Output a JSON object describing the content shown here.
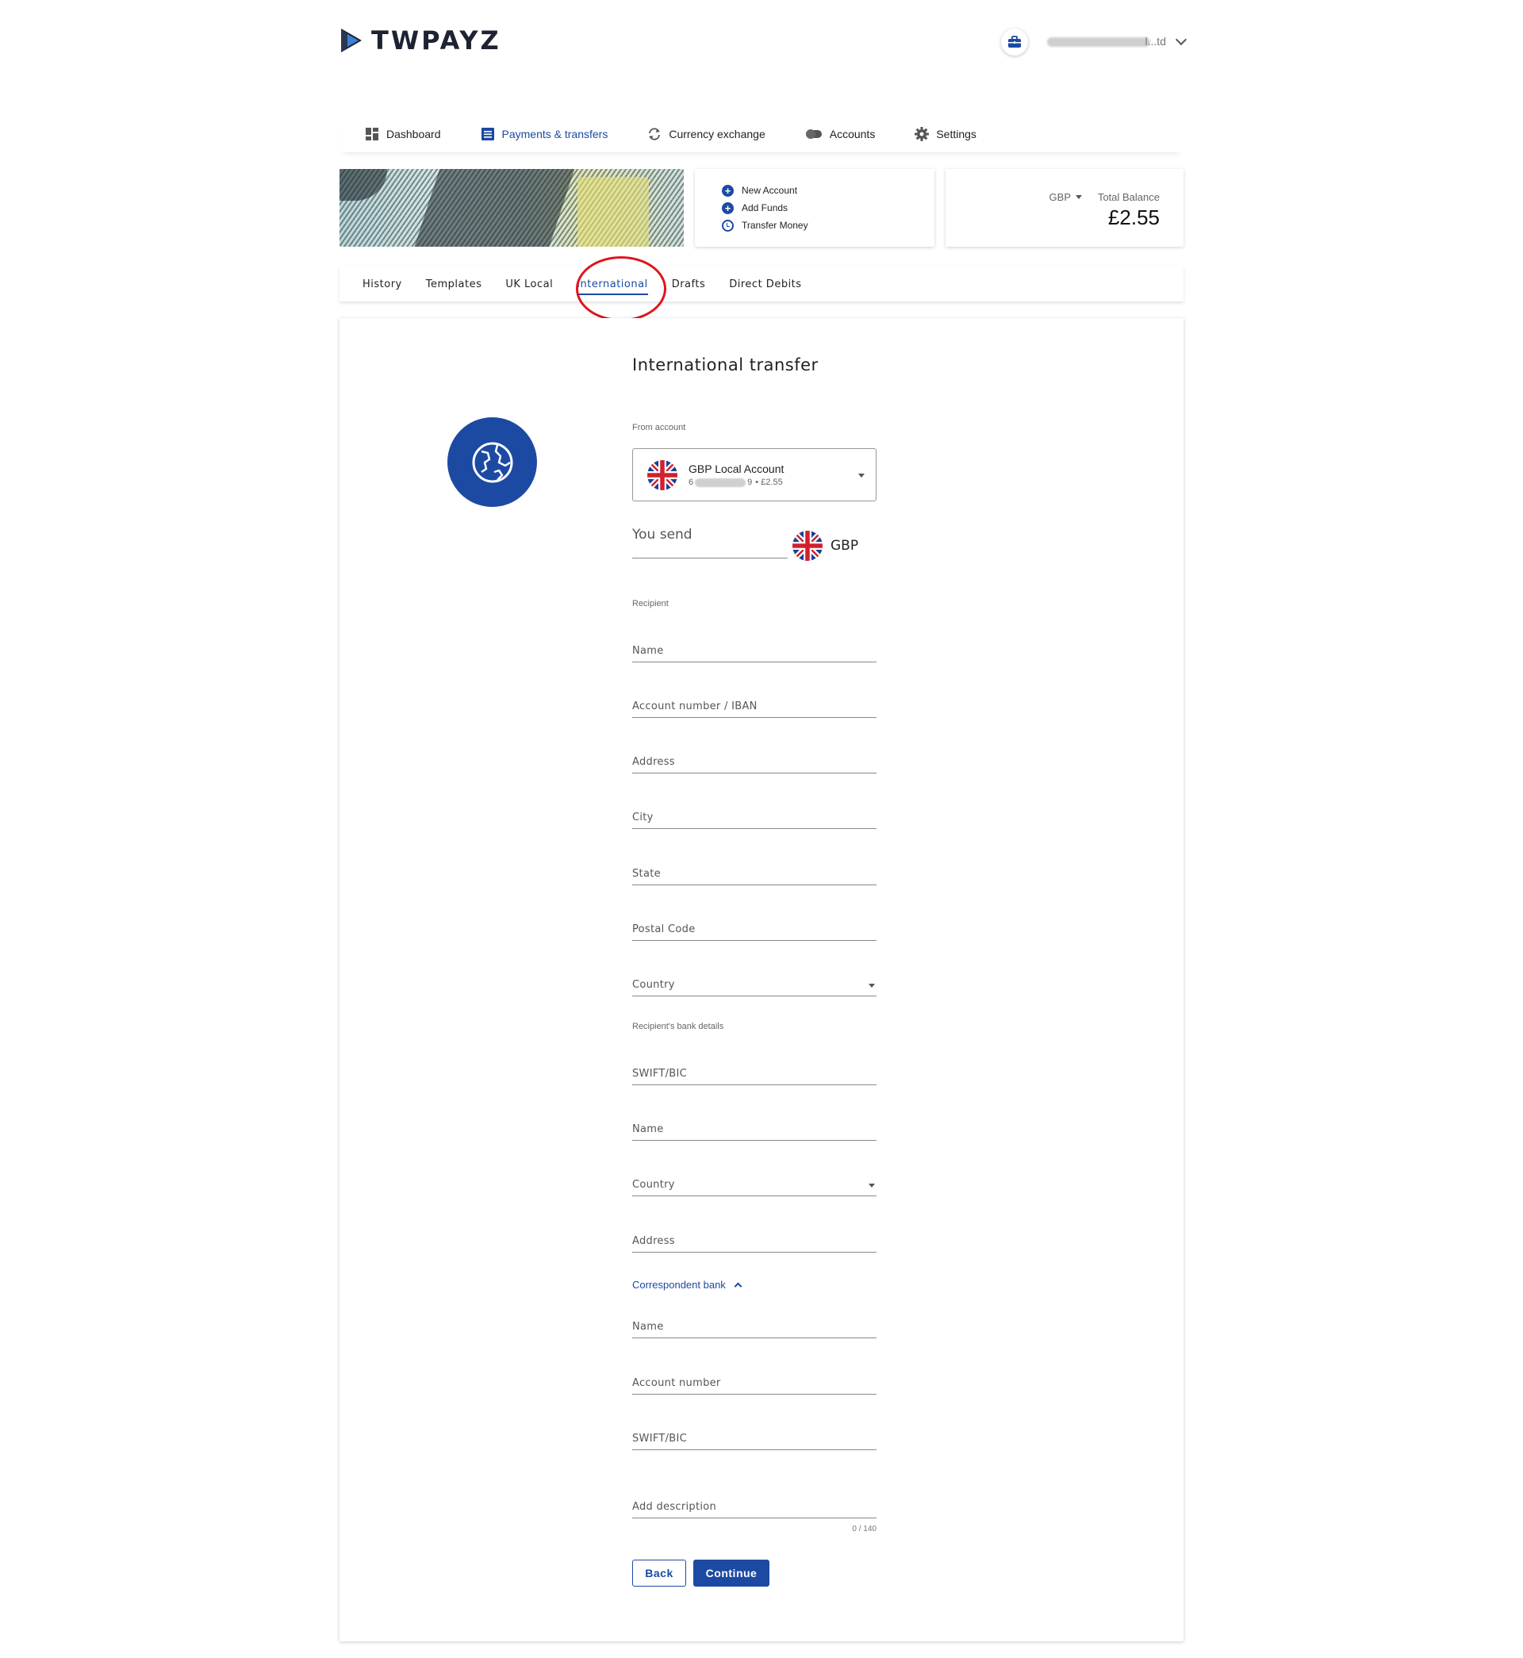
{
  "header": {
    "brand": "TWPAYZ",
    "user_name": "l...td"
  },
  "nav": [
    {
      "label": "Dashboard",
      "icon": "dashboard-icon"
    },
    {
      "label": "Payments & transfers",
      "icon": "document-list-icon",
      "active": true
    },
    {
      "label": "Currency exchange",
      "icon": "exchange-arrows-icon"
    },
    {
      "label": "Accounts",
      "icon": "toggle-accounts-icon"
    },
    {
      "label": "Settings",
      "icon": "gear-icon"
    }
  ],
  "quick_actions": [
    {
      "label": "New Account",
      "icon": "plus-circle-icon"
    },
    {
      "label": "Add Funds",
      "icon": "plus-circle-icon"
    },
    {
      "label": "Transfer Money",
      "icon": "clock-circle-icon"
    }
  ],
  "balance": {
    "currency": "GBP",
    "label": "Total Balance",
    "amount": "£2.55"
  },
  "subtabs": [
    {
      "label": "History"
    },
    {
      "label": "Templates"
    },
    {
      "label": "UK Local"
    },
    {
      "label": "International",
      "active": true
    },
    {
      "label": "Drafts"
    },
    {
      "label": "Direct Debits"
    }
  ],
  "form": {
    "title": "International transfer",
    "from_account_label": "From account",
    "from_account": {
      "name": "GBP Local Account",
      "number_prefix": "6",
      "number_suffix": "9",
      "balance": "• £2.55"
    },
    "you_send_placeholder": "You send",
    "send_currency": "GBP",
    "recipient_label": "Recipient",
    "recipient_fields": {
      "name": "Name",
      "account_number": "Account number / IBAN",
      "address": "Address",
      "city": "City",
      "state": "State",
      "postal_code": "Postal Code",
      "country": "Country"
    },
    "bank_label": "Recipient's bank details",
    "bank_fields": {
      "swift": "SWIFT/BIC",
      "name": "Name",
      "country": "Country",
      "address": "Address"
    },
    "correspondent_label": "Correspondent bank",
    "correspondent_fields": {
      "name": "Name",
      "account_number": "Account number",
      "swift": "SWIFT/BIC"
    },
    "description_placeholder": "Add description",
    "description_counter": "0 / 140",
    "back_label": "Back",
    "continue_label": "Continue"
  },
  "colors": {
    "accent": "#1c4aa3",
    "highlight": "#e0141e"
  }
}
